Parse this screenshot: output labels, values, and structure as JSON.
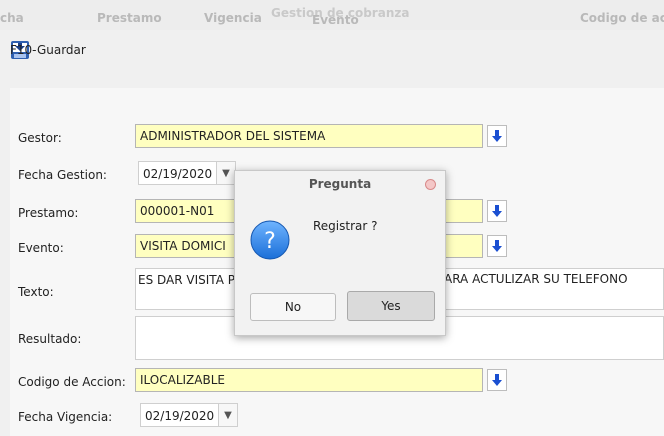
{
  "column_header": {
    "col1": "cha",
    "col2": "Prestamo",
    "col3": "Vigencia",
    "col4": "Gestion de cobranza",
    "col5": "Evento",
    "col6": "Codigo de ac"
  },
  "toolbar": {
    "save_label": "F10-Guardar"
  },
  "form": {
    "gestor_label": "Gestor:",
    "gestor_value": "ADMINISTRADOR DEL SISTEMA",
    "fecha_gestion_label": "Fecha Gestion:",
    "fecha_gestion_value": "02/19/2020",
    "prestamo_label": "Prestamo:",
    "prestamo_value": "000001-N01",
    "evento_label": "Evento:",
    "evento_value": "VISITA DOMICI",
    "texto_label": "Texto:",
    "texto_value_left": "ES DAR VISITA P",
    "texto_value_right": "ARA ACTULIZAR SU TELEFONO",
    "resultado_label": "Resultado:",
    "codigo_label": "Codigo de Accion:",
    "codigo_value": "ILOCALIZABLE",
    "fecha_vigencia_label": "Fecha Vigencia:",
    "fecha_vigencia_value": "02/19/2020"
  },
  "dialog": {
    "title": "Pregunta",
    "message": "Registrar ?",
    "no_label": "No",
    "yes_label": "Yes"
  },
  "colors": {
    "required_field": "#ffffc0",
    "picker_arrow": "#1a4fd1"
  }
}
